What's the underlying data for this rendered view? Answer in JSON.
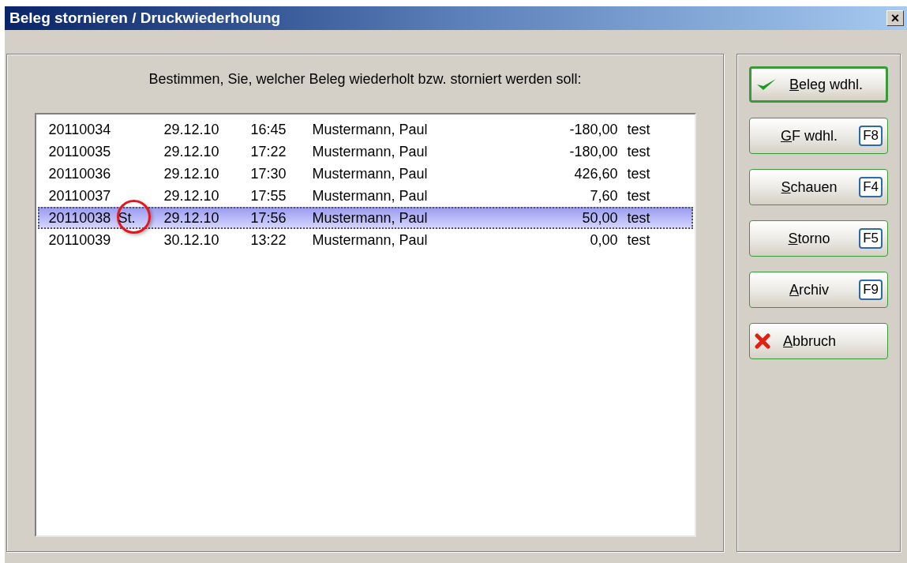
{
  "window": {
    "title": "Beleg stornieren / Druckwiederholung",
    "close": "×"
  },
  "prompt": "Bestimmen, Sie, welcher Beleg wiederholt bzw. storniert werden soll:",
  "rows": [
    {
      "number": "20110034",
      "date": "29.12.10",
      "time": "16:45",
      "name": "Mustermann, Paul",
      "amount": "-180,00",
      "note": "test",
      "selected": false
    },
    {
      "number": "20110035",
      "date": "29.12.10",
      "time": "17:22",
      "name": "Mustermann, Paul",
      "amount": "-180,00",
      "note": "test",
      "selected": false
    },
    {
      "number": "20110036",
      "date": "29.12.10",
      "time": "17:30",
      "name": "Mustermann, Paul",
      "amount": "426,60",
      "note": "test",
      "selected": false
    },
    {
      "number": "20110037",
      "date": "29.12.10",
      "time": "17:55",
      "name": "Mustermann, Paul",
      "amount": "7,60",
      "note": "test",
      "selected": false
    },
    {
      "number": "20110038",
      "flag": "St.",
      "circled": true,
      "date": "29.12.10",
      "time": "17:56",
      "name": "Mustermann, Paul",
      "amount": "50,00",
      "note": "test",
      "selected": true
    },
    {
      "number": "20110039",
      "date": "30.12.10",
      "time": "13:22",
      "name": "Mustermann, Paul",
      "amount": "0,00",
      "note": "test",
      "selected": false
    }
  ],
  "buttons": [
    {
      "kind": "check",
      "label": "Beleg wdhl.",
      "default": true
    },
    {
      "kind": "plain",
      "label": "GF wdhl.",
      "key": "F8",
      "default": false
    },
    {
      "kind": "plain",
      "label": "Schauen",
      "key": "F4",
      "default": false
    },
    {
      "kind": "plain",
      "label": "Storno",
      "key": "F5",
      "default": false
    },
    {
      "kind": "plain",
      "label": "Archiv",
      "key": "F9",
      "default": false
    },
    {
      "kind": "cancel",
      "label": "Abbruch",
      "default": false
    }
  ]
}
